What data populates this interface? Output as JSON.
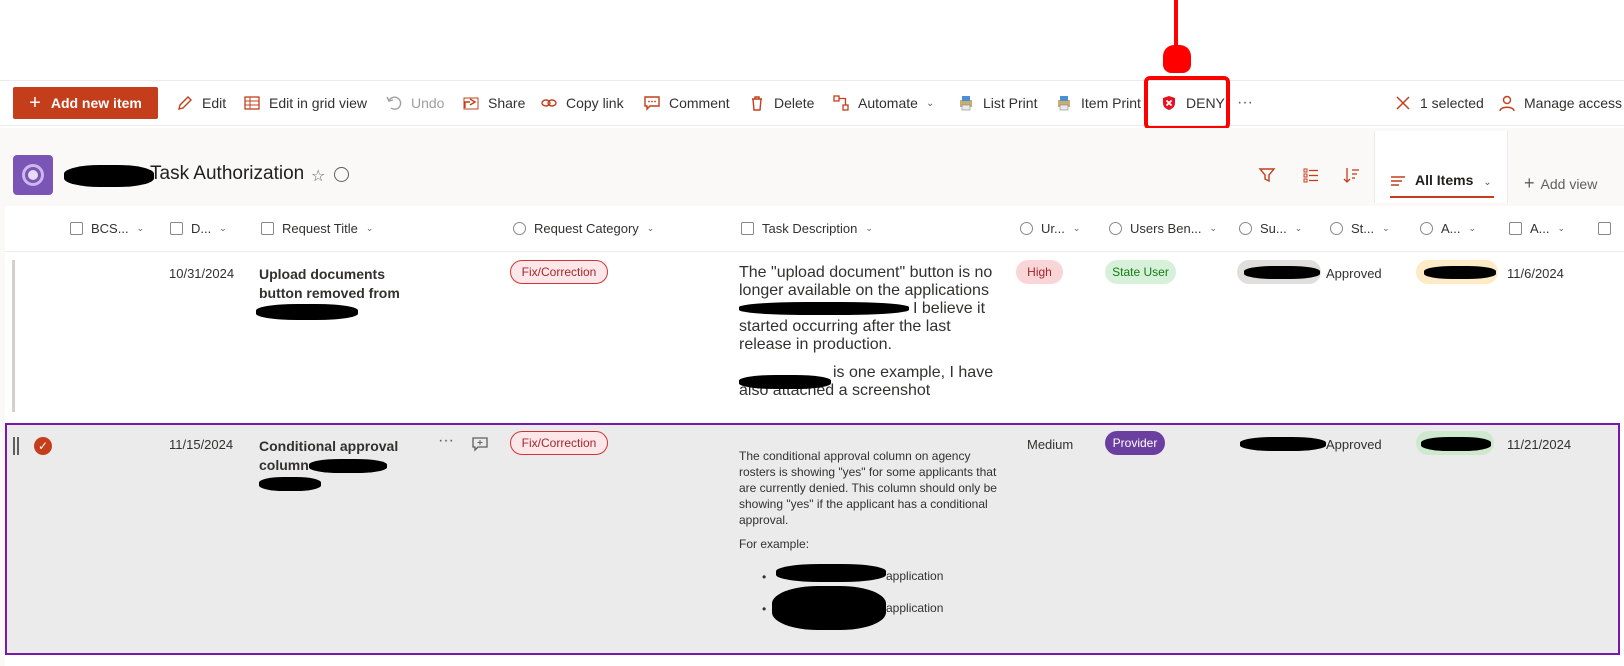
{
  "commandbar": {
    "add_new_item": "Add new item",
    "edit": "Edit",
    "edit_grid": "Edit in grid view",
    "undo": "Undo",
    "share": "Share",
    "copy_link": "Copy link",
    "comment": "Comment",
    "delete": "Delete",
    "automate": "Automate",
    "list_print": "List Print",
    "item_print": "Item Print",
    "deny": "DENY",
    "more": "···",
    "selected": "1 selected",
    "manage_access": "Manage access"
  },
  "header": {
    "title": "Task Authorization",
    "all_items": "All Items",
    "add_view": "Add view"
  },
  "columns": [
    "BCS...",
    "D...",
    "Request Title",
    "Request Category",
    "Task Description",
    "Ur...",
    "Users Ben...",
    "Su...",
    "St...",
    "A...",
    "A..."
  ],
  "rows": [
    {
      "date": "10/31/2024",
      "title_line1": "Upload documents",
      "title_line2": "button removed from",
      "category": "Fix/Correction",
      "desc_p1_a": "The \"upload document\" button is no longer available on the applications",
      "desc_p1_b": "I believe it started occurring after the last release in production.",
      "desc_p2": "is one example, I have also attached a screenshot",
      "urgency": "High",
      "users": "State User",
      "status": "Approved",
      "approved_date": "11/6/2024"
    },
    {
      "date": "11/15/2024",
      "title_line1": "Conditional approval",
      "title_line2": "column",
      "category": "Fix/Correction",
      "desc_p1": "The conditional approval column on agency rosters is showing \"yes\" for some applicants that are currently denied. This column should only be showing \"yes\" if the applicant has a conditional approval.",
      "desc_p2": "For example:",
      "bullet1": "application",
      "bullet2": "application",
      "urgency": "Medium",
      "users": "Provider",
      "status": "Approved",
      "approved_date": "11/21/2024"
    }
  ],
  "colors": {
    "accent": "#c43e1c",
    "selection_border": "#7719aa",
    "annotation": "#ff0000"
  }
}
